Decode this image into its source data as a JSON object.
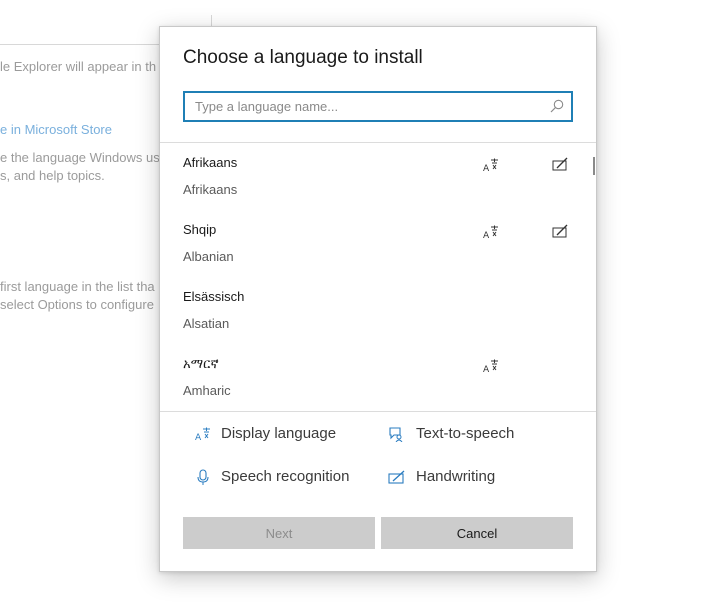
{
  "background": {
    "line1": "le Explorer will appear in th",
    "link": "e in Microsoft Store",
    "line3": "e the language Windows us",
    "line4": "s, and help topics.",
    "line5": "first language in the list tha",
    "line6": "select Options to configure"
  },
  "dialog": {
    "title": "Choose a language to install",
    "search": {
      "placeholder": "Type a language name..."
    },
    "languages": [
      {
        "native": "Afrikaans",
        "english": "Afrikaans",
        "display": true,
        "handwriting": true
      },
      {
        "native": "Shqip",
        "english": "Albanian",
        "display": true,
        "handwriting": true
      },
      {
        "native": "Elsässisch",
        "english": "Alsatian",
        "display": false,
        "handwriting": false
      },
      {
        "native": "አማርኛ",
        "english": "Amharic",
        "display": true,
        "handwriting": false
      }
    ],
    "legend": {
      "display": "Display language",
      "tts": "Text-to-speech",
      "speech": "Speech recognition",
      "handwriting": "Handwriting"
    },
    "buttons": {
      "next": "Next",
      "cancel": "Cancel"
    }
  },
  "colors": {
    "accent": "#1f7fb5",
    "icon_blue": "#2a7cc0",
    "button_bg": "#cccccc"
  }
}
